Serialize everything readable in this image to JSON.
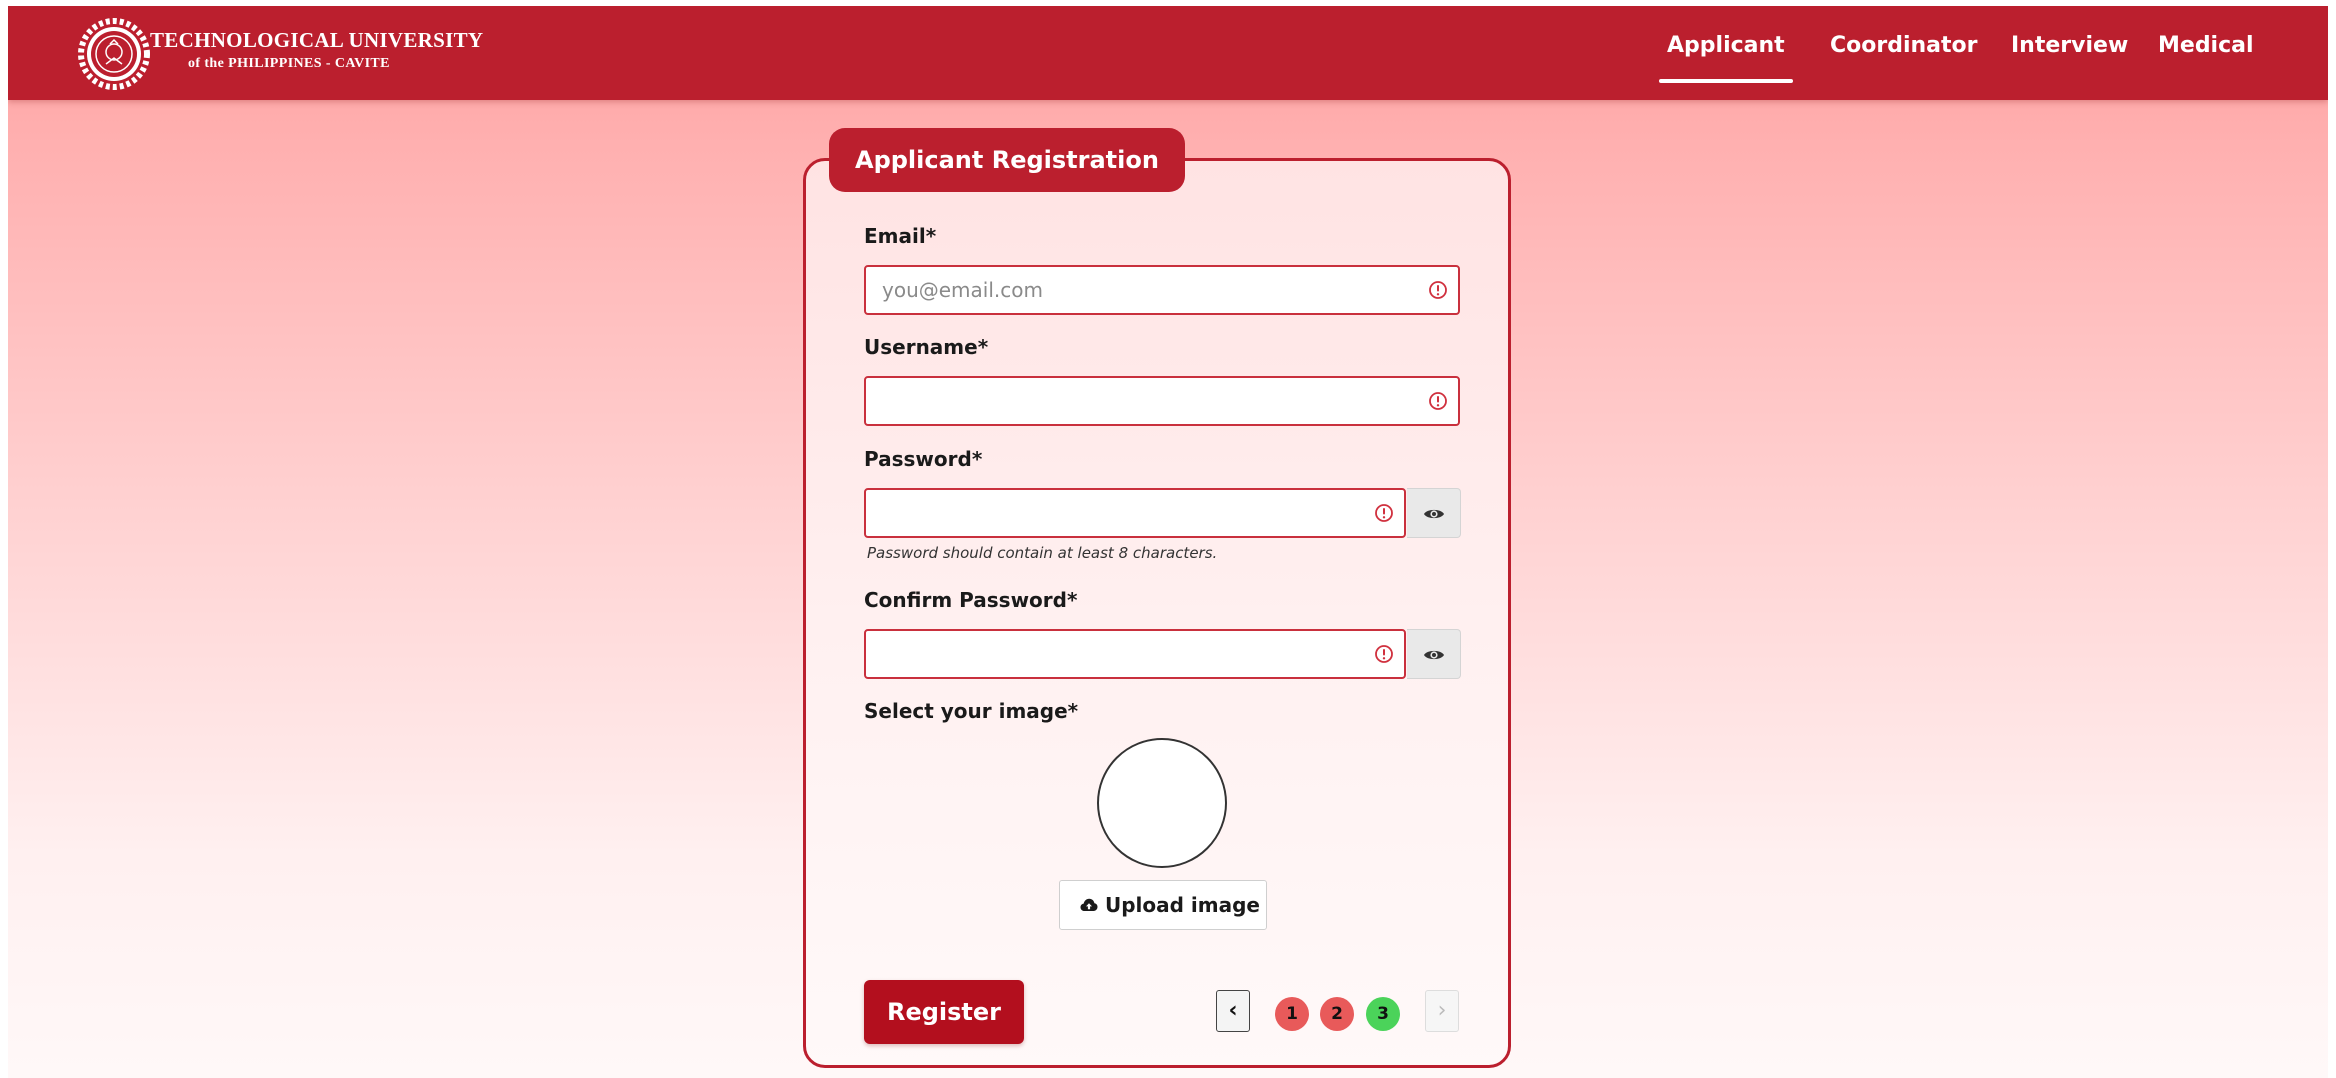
{
  "header": {
    "logo_title": "TECHNOLOGICAL UNIVERSITY",
    "logo_subtitle": "of the PHILIPPINES - CAVITE",
    "nav": [
      {
        "label": "Applicant",
        "active": true
      },
      {
        "label": "Coordinator",
        "active": false
      },
      {
        "label": "Interview",
        "active": false
      },
      {
        "label": "Medical",
        "active": false
      }
    ]
  },
  "form": {
    "title": "Applicant Registration",
    "email": {
      "label": "Email*",
      "placeholder": "you@email.com",
      "value": ""
    },
    "username": {
      "label": "Username*",
      "placeholder": "",
      "value": ""
    },
    "password": {
      "label": "Password*",
      "value": "",
      "helper": "Password should contain at least 8 characters."
    },
    "confirm_password": {
      "label": "Confirm Password*",
      "value": ""
    },
    "image": {
      "label": "Select your image*",
      "upload_label": "Upload image"
    },
    "register_label": "Register"
  },
  "pagination": {
    "prev_symbol": "‹",
    "next_symbol": "›",
    "pages": [
      {
        "label": "1",
        "color": "#e85a5a"
      },
      {
        "label": "2",
        "color": "#e85a5a"
      },
      {
        "label": "3",
        "color": "#4bd35a"
      }
    ]
  },
  "colors": {
    "brand": "#bb1f2e",
    "register": "#b30f1e",
    "error": "#c9303d"
  },
  "icons": {
    "field_status": "alert-circle-icon",
    "password_toggle": "eye-icon",
    "upload": "cloud-upload-icon"
  }
}
